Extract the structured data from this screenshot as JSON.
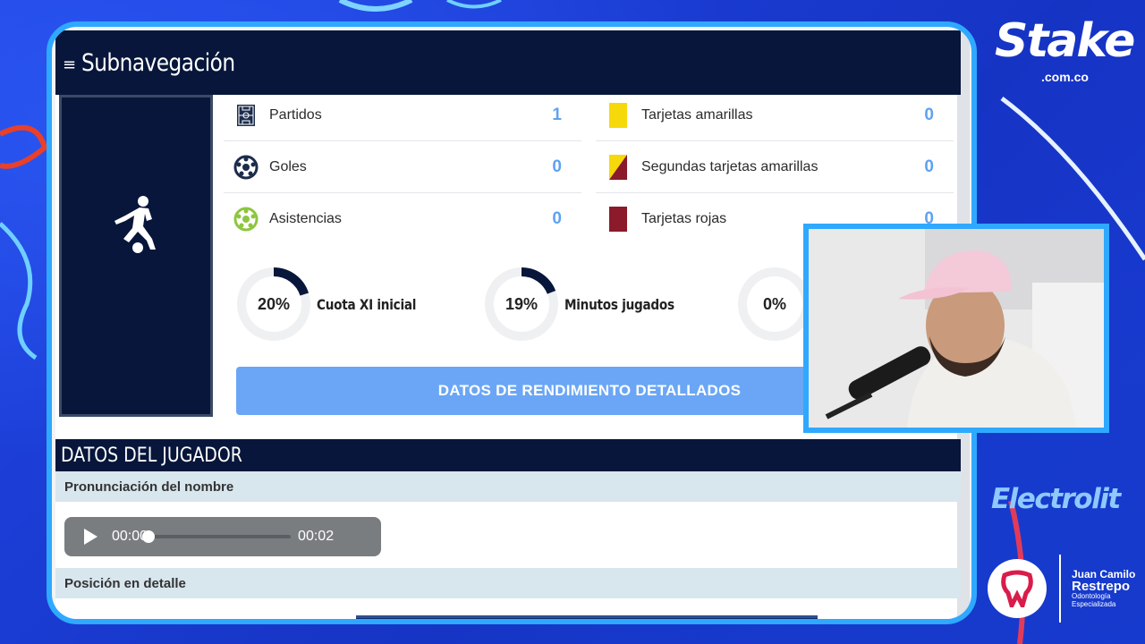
{
  "header": {
    "menu_icon": "≡",
    "title": "Subnavegación"
  },
  "stats_left": [
    {
      "icon": "pitch-icon",
      "label": "Partidos",
      "value": "1"
    },
    {
      "icon": "ball-icon",
      "label": "Goles",
      "value": "0"
    },
    {
      "icon": "assist-ball-icon",
      "label": "Asistencias",
      "value": "0"
    }
  ],
  "stats_right": [
    {
      "icon": "yellow-card-icon",
      "label": "Tarjetas amarillas",
      "value": "0"
    },
    {
      "icon": "second-yellow-card-icon",
      "label": "Segundas tarjetas amarillas",
      "value": "0"
    },
    {
      "icon": "red-card-icon",
      "label": "Tarjetas rojas",
      "value": "0"
    }
  ],
  "donuts": [
    {
      "percent": 20,
      "text": "20%",
      "label": "Cuota XI inicial"
    },
    {
      "percent": 19,
      "text": "19%",
      "label": "Minutos jugados"
    },
    {
      "percent": 0,
      "text": "0%",
      "label": ""
    }
  ],
  "performance_button": "DATOS DE RENDIMIENTO DETALLADOS",
  "player_data": {
    "title": "DATOS DEL JUGADOR",
    "pronunciation_label": "Pronunciación del nombre",
    "audio": {
      "current": "00:00",
      "duration": "00:02",
      "progress": 0
    },
    "position_label": "Posición en detalle"
  },
  "sponsors": {
    "stake": "Stake",
    "stake_domain": ".com.co",
    "electrolit": "Electrolit",
    "dentist_line1": "Juan Camilo",
    "dentist_line2": "Restrepo",
    "dentist_line3": "Odontología",
    "dentist_line4": "Especializada"
  },
  "colors": {
    "navy": "#07163a",
    "value_blue": "#5ea2f0",
    "button_blue": "#6aa6f5",
    "frame_cyan": "#2fa9ff",
    "yellow_card": "#f5d90a",
    "red_card": "#8b1a2b"
  }
}
